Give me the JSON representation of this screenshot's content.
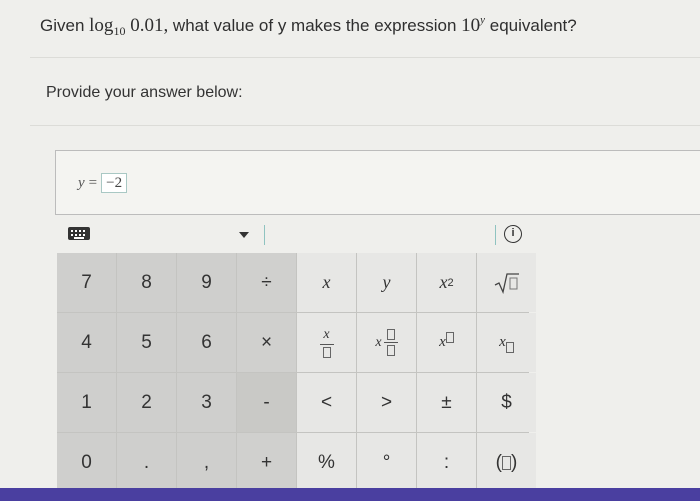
{
  "question": {
    "prefix": "Given",
    "log_word": "log",
    "log_base": "10",
    "log_arg": "0.01,",
    "middle": "what value of y makes the expression",
    "power_base": "10",
    "power_exp": "y",
    "suffix": "equivalent?"
  },
  "prompt": "Provide your answer below:",
  "answer": {
    "variable": "y",
    "equals": "=",
    "value": "−2"
  },
  "toolbar": {
    "keyboard_icon": "keyboard-icon",
    "dropdown_icon": "caret-down-icon",
    "info_label": "i"
  },
  "keypad": {
    "rows": [
      [
        "7",
        "8",
        "9",
        "÷",
        "x",
        "y",
        "x²",
        "√□"
      ],
      [
        "4",
        "5",
        "6",
        "×",
        "x/□",
        "x □/□",
        "x□",
        "x□ (subscript)"
      ],
      [
        "1",
        "2",
        "3",
        "-",
        "<",
        ">",
        "±",
        "$"
      ],
      [
        "0",
        ".",
        ",",
        "+",
        "%",
        "°",
        ":",
        "(□)"
      ]
    ],
    "k7": "7",
    "k8": "8",
    "k9": "9",
    "div": "÷",
    "x": "x",
    "y": "y",
    "x2_base": "x",
    "x2_exp": "2",
    "k4": "4",
    "k5": "5",
    "k6": "6",
    "times": "×",
    "frac_x": "x",
    "mixed_x": "x",
    "pow_x": "x",
    "sub_x": "x",
    "k1": "1",
    "k2": "2",
    "k3": "3",
    "minus": "-",
    "lt": "<",
    "gt": ">",
    "pm": "±",
    "dollar": "$",
    "k0": "0",
    "dot": ".",
    "comma": ",",
    "plus": "+",
    "percent": "%",
    "degree": "°",
    "colon": ":",
    "paren_open": "(",
    "paren_close": ")"
  },
  "colors": {
    "accent_bar": "#4a3fa0",
    "field_border": "#a9c8c4"
  }
}
